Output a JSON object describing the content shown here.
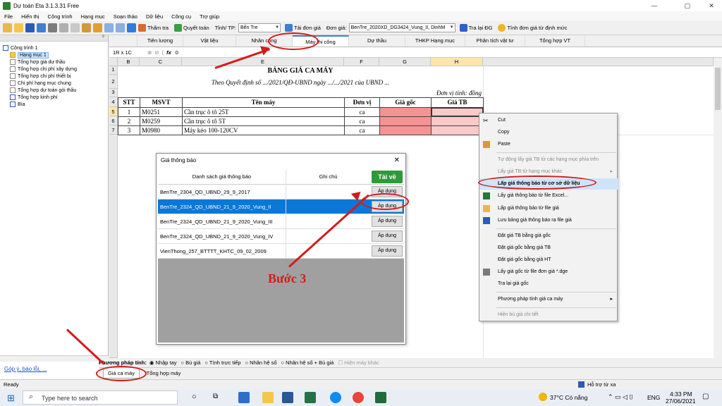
{
  "window": {
    "title": "Dự toán Eta 3.1.3.31 Free",
    "minimize": "—",
    "maximize": "▢",
    "close": "✕"
  },
  "menu": [
    "File",
    "Hiển thị",
    "Công trình",
    "Hạng mục",
    "Soạn thảo",
    "Dữ liệu",
    "Công cụ",
    "Trợ giúp"
  ],
  "toolbar": {
    "tham_tra": "Thẩm tra",
    "quyet_toan": "Quyết toán",
    "tinh_label": "Tỉnh/ TP:",
    "tinh_value": "Bến Tre",
    "tai_don_gia": "Tải đơn giá",
    "don_gia_label": "Đơn giá:",
    "don_gia_value": "BenTre_2020XD_DG3424_Vung_II, DinhM",
    "tra_lai_dg": "Tra lại ĐG",
    "tinh_don_gia": "Tính đơn giá từ định mức"
  },
  "tree": {
    "root": "Công trình 1",
    "items": [
      "Hạng mục 1",
      "Tổng hợp giá dự thầu",
      "Tổng hợp chi phí xây dựng",
      "Tổng hợp chi phí thiết bị",
      "Chi phí hạng mục chung",
      "Tổng hợp dự toán gói thầu",
      "Tổng hợp kinh phí",
      "Bìa"
    ]
  },
  "feedback_link": "Góp ý, báo lỗi, ...",
  "top_tabs": [
    "Tiên lượng",
    "Vật liệu",
    "Nhân công",
    "Máy thi công",
    "Dự thầu",
    "THKP Hạng mục",
    "Phân tích vật tư",
    "Tổng hợp VT"
  ],
  "formula": {
    "cell_ref": "1R x 1C",
    "fx": "fx",
    "value": "0"
  },
  "columns": [
    "B",
    "C",
    "E",
    "F",
    "G",
    "H"
  ],
  "rows": [
    "1",
    "2",
    "3",
    "4",
    "5",
    "6",
    "7"
  ],
  "sheet": {
    "title": "BẢNG GIÁ CA MÁY",
    "subtitle": "Theo Quyết định số .../2021/QĐ-UBND ngày .../.../2021 của UBND ...",
    "unit": "Đơn vị tính: đồng",
    "headers": [
      "STT",
      "MSVT",
      "Tên máy",
      "Đơn vị",
      "Giá gốc",
      "Giá TB"
    ],
    "data": [
      [
        "1",
        "M0251",
        "Cần trục ô tô 25T",
        "ca"
      ],
      [
        "2",
        "M0259",
        "Cần trục ô tô 5T",
        "ca"
      ],
      [
        "3",
        "M0980",
        "Máy kéo 100-120CV",
        "ca"
      ]
    ]
  },
  "dialog": {
    "title": "Giá thông báo",
    "col_list": "Danh sách giá thông báo",
    "col_note": "Ghi chú",
    "download": "Tải về",
    "apply_label": "Áp dụng",
    "items": [
      "BenTre_2304_QD_UBND_29_9_2017",
      "BenTre_2324_QD_UBND_21_9_2020_Vung_II",
      "BenTre_2324_QD_UBND_21_9_2020_Vung_III",
      "BenTre_2324_QD_UBND_21_9_2020_Vung_IV",
      "VienThong_257_BTTTT_KHTC_09_02_2009"
    ]
  },
  "annotation": "Bước 3",
  "context_menu": {
    "cut": "Cut",
    "copy": "Copy",
    "paste": "Paste",
    "auto": "Tự động lấy giá TB từ các hạng mục phía trên",
    "from_hm": "Lấy giá TB từ hạng mục khác",
    "from_db": "Lấp giá thông báo từ cơ sở dữ liệu",
    "from_excel": "Lấy giá thông báo từ file Excel...",
    "from_file": "Lấp giá thông báo từ file giá",
    "save_file": "Lưu bảng giá thông báo ra file giá",
    "tb_eq_goc": "Đặt giá TB bằng giá gốc",
    "goc_eq_tb": "Đặt giá gốc bằng giá TB",
    "goc_eq_ht": "Đặt giá gốc bằng giá HT",
    "goc_from_dge": "Lấy giá gốc từ file đơn giá *.dge",
    "lookup": "Tra lại giá gốc",
    "method": "Phương pháp tính giá ca máy",
    "detail": "Hiện bù giá chi tiết"
  },
  "bottom": {
    "method_label": "Phương pháp tính:",
    "options": [
      "Nhập tay",
      "Bù giá",
      "Tính trực tiếp",
      "Nhân hệ số",
      "Nhân hệ số + Bù giá"
    ],
    "hide_label": "Hiện máy khác"
  },
  "sheet_tabs": [
    "Giá ca máy",
    "Tổng hợp máy"
  ],
  "status": {
    "left": "Ready",
    "right": "Hỗ trợ từ xa"
  },
  "taskbar": {
    "search": "Type here to search",
    "weather": "37°C Có nắng",
    "lang": "ENG",
    "time": "4:33 PM",
    "date": "27/06/2021"
  }
}
